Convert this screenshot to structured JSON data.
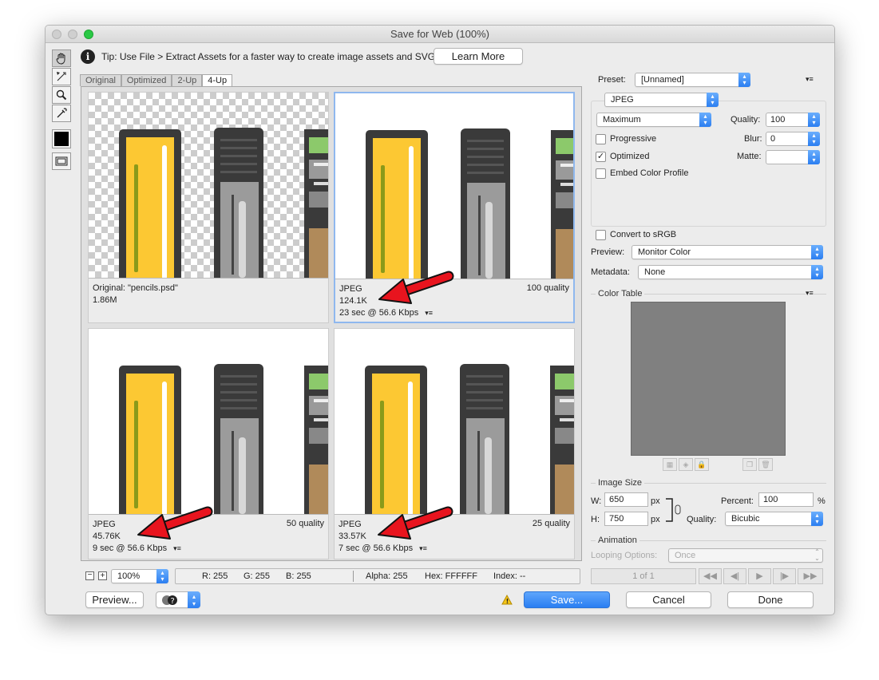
{
  "window": {
    "title": "Save for Web (100%)"
  },
  "tip": {
    "text": "Tip: Use File > Extract Assets for a faster way to create image assets and SVG",
    "learn_more": "Learn More"
  },
  "tabs": [
    "Original",
    "Optimized",
    "2-Up",
    "4-Up"
  ],
  "panes": [
    {
      "line1": "Original: \"pencils.psd\"",
      "line2": "1.86M",
      "line3": "",
      "quality": ""
    },
    {
      "line1": "JPEG",
      "line2": "124.1K",
      "line3": "23 sec @ 56.6 Kbps",
      "quality": "100 quality"
    },
    {
      "line1": "JPEG",
      "line2": "45.76K",
      "line3": "9 sec @ 56.6 Kbps",
      "quality": "50 quality"
    },
    {
      "line1": "JPEG",
      "line2": "33.57K",
      "line3": "7 sec @ 56.6 Kbps",
      "quality": "25 quality"
    }
  ],
  "status": {
    "zoom": "100%",
    "r": "R: 255",
    "g": "G: 255",
    "b": "B: 255",
    "alpha": "Alpha: 255",
    "hex": "Hex: FFFFFF",
    "index": "Index: --"
  },
  "bottom": {
    "preview": "Preview...",
    "save": "Save...",
    "cancel": "Cancel",
    "done": "Done"
  },
  "settings": {
    "preset_label": "Preset:",
    "preset": "[Unnamed]",
    "format": "JPEG",
    "compression": "Maximum",
    "quality_label": "Quality:",
    "quality": "100",
    "progressive": "Progressive",
    "blur_label": "Blur:",
    "blur": "0",
    "optimized": "Optimized",
    "matte_label": "Matte:",
    "embed": "Embed Color Profile",
    "convert": "Convert to sRGB",
    "preview_label": "Preview:",
    "preview_val": "Monitor Color",
    "metadata_label": "Metadata:",
    "metadata_val": "None",
    "color_table": "Color Table",
    "image_size": "Image Size",
    "w_label": "W:",
    "w": "650",
    "h_label": "H:",
    "h": "750",
    "px": "px",
    "percent_label": "Percent:",
    "percent": "100",
    "pct": "%",
    "rquality_label": "Quality:",
    "rquality": "Bicubic",
    "animation": "Animation",
    "looping_label": "Looping Options:",
    "looping": "Once",
    "frame": "1 of 1"
  },
  "colors": {
    "accent": "#2a7ef2",
    "arrow": "#e8141e",
    "pencil_yellow": "#fcc833",
    "pencil_dark": "#3a3a3a",
    "color_table": "#808080"
  }
}
